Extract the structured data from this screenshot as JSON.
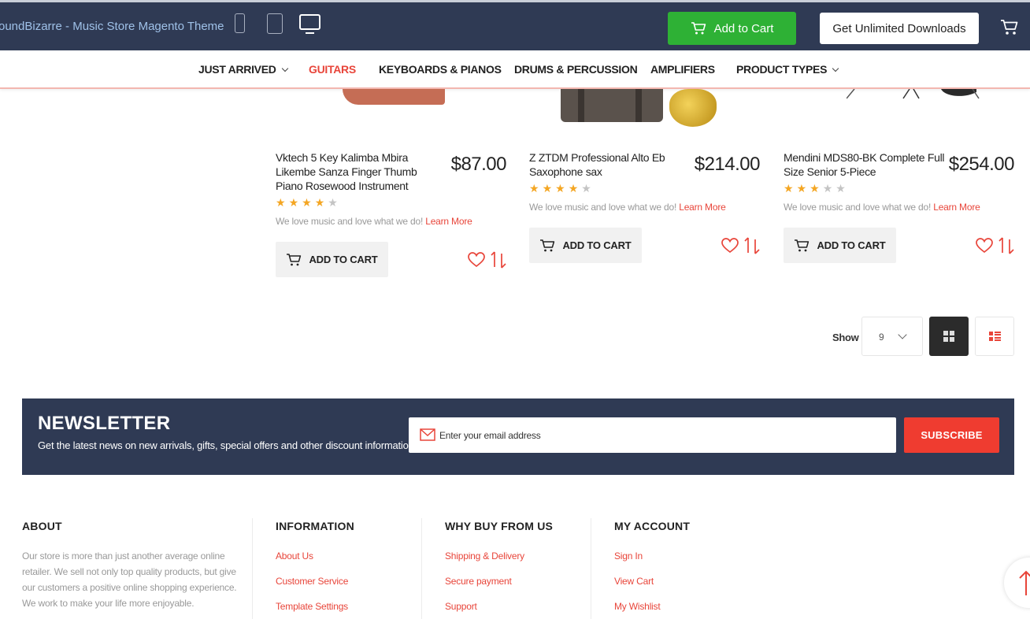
{
  "topbar": {
    "brand": "oundBizarre - Music Store Magento Theme",
    "devices": [
      "phone-icon",
      "tablet-icon",
      "desktop-icon"
    ],
    "add_to_cart": "Add to Cart",
    "unlimited": "Get Unlimited Downloads"
  },
  "nav": {
    "items": [
      {
        "label": "JUST ARRIVED",
        "dropdown": true
      },
      {
        "label": "GUITARS",
        "active": true
      },
      {
        "label": "KEYBOARDS & PIANOS"
      },
      {
        "label": "DRUMS & PERCUSSION"
      },
      {
        "label": "AMPLIFIERS"
      },
      {
        "label": "PRODUCT TYPES",
        "dropdown": true
      }
    ]
  },
  "products": [
    {
      "title": "Vktech 5 Key Kalimba Mbira Likembe Sanza Finger Thumb Piano Rosewood Instrument",
      "price": "$87.00",
      "rating": 4,
      "desc": "We love music and love what we do!",
      "learn_more": "Learn More",
      "add_to_cart": "ADD TO CART"
    },
    {
      "title": "Z ZTDM Professional Alto Eb Saxophone sax",
      "price": "$214.00",
      "rating": 4,
      "desc": "We love music and love what we do!",
      "learn_more": "Learn More",
      "add_to_cart": "ADD TO CART"
    },
    {
      "title": "Mendini MDS80-BK Complete Full Size Senior 5-Piece",
      "price": "$254.00",
      "rating": 3,
      "desc": "We love music and love what we do!",
      "learn_more": "Learn More",
      "add_to_cart": "ADD TO CART"
    }
  ],
  "toolbar": {
    "show_label": "Show",
    "limit_value": "9"
  },
  "newsletter": {
    "title": "NEWSLETTER",
    "subtitle": "Get the latest news on new arrivals, gifts, special offers and other discount information.",
    "placeholder": "Enter your email address",
    "button": "SUBSCRIBE"
  },
  "footer": {
    "about": {
      "heading": "ABOUT",
      "text": "Our store is more than just another average online retailer. We sell not only top quality products, but give our customers a positive online shopping experience. We work to make your life more enjoyable."
    },
    "information": {
      "heading": "INFORMATION",
      "links": [
        "About Us",
        "Customer Service",
        "Template Settings"
      ]
    },
    "why_buy": {
      "heading": "WHY BUY FROM US",
      "links": [
        "Shipping & Delivery",
        "Secure payment",
        "Support"
      ]
    },
    "account": {
      "heading": "MY ACCOUNT",
      "links": [
        "Sign In",
        "View Cart",
        "My Wishlist"
      ]
    }
  },
  "colors": {
    "navy": "#2f3a54",
    "accent": "#e8453a",
    "green": "#2eb135",
    "star": "#f4a623"
  }
}
